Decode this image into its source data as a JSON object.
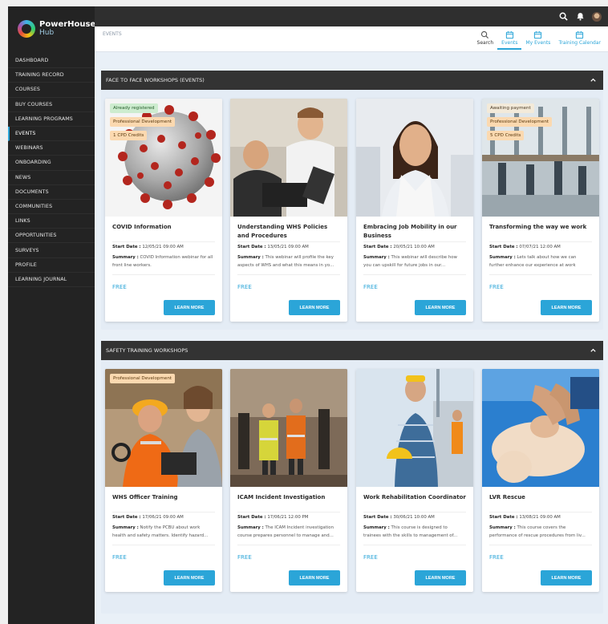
{
  "app": {
    "logo_line1": "PowerHouse",
    "logo_line2": "Hub"
  },
  "sidebar": {
    "items": [
      {
        "label": "DASHBOARD"
      },
      {
        "label": "TRAINING RECORD"
      },
      {
        "label": "COURSES"
      },
      {
        "label": "BUY COURSES"
      },
      {
        "label": "LEARNING PROGRAMS"
      },
      {
        "label": "EVENTS",
        "active": true
      },
      {
        "label": "WEBINARS"
      },
      {
        "label": "ONBOARDING"
      },
      {
        "label": "NEWS"
      },
      {
        "label": "DOCUMENTS"
      },
      {
        "label": "COMMUNITIES"
      },
      {
        "label": "LINKS"
      },
      {
        "label": "OPPORTUNITIES"
      },
      {
        "label": "SURVEYS"
      },
      {
        "label": "PROFILE"
      },
      {
        "label": "LEARNING JOURNAL"
      }
    ]
  },
  "breadcrumb": "EVENTS",
  "subnav": {
    "search": "Search",
    "events": "Events",
    "my_events": "My Events",
    "training_calendar": "Training Calendar"
  },
  "colors": {
    "accent": "#2ba5d8",
    "sidebar_bg": "#232323",
    "section_head": "#333333"
  },
  "sections": [
    {
      "title": "FACE TO FACE WORKSHOPS (EVENTS)",
      "cards": [
        {
          "title": "COVID Information",
          "badges": [
            "Already registered",
            "Professional Development",
            "1 CPD Credits"
          ],
          "start_label": "Start Date :",
          "start_date": "12/05/21 09:00 AM",
          "summary_label": "Summary :",
          "summary": "COVID Information webinar for all front line workers.",
          "price": "FREE",
          "button": "LEARN MORE"
        },
        {
          "title": "Understanding WHS Policies and Procedures",
          "badges": [],
          "start_label": "Start Date :",
          "start_date": "13/05/21 09:00 AM",
          "summary_label": "Summary :",
          "summary": "This webinar will profile the key aspects of WHS and what this means in yo...",
          "price": "FREE",
          "button": "LEARN MORE"
        },
        {
          "title": "Embracing Job Mobility in our Business",
          "badges": [],
          "start_label": "Start Date :",
          "start_date": "20/05/21 10:00 AM",
          "summary_label": "Summary :",
          "summary": "This webinar will describe how you can upskill for future jobs in our...",
          "price": "FREE",
          "button": "LEARN MORE"
        },
        {
          "title": "Transforming the way we work",
          "badges": [
            "Awaiting payment",
            "Professional Development",
            "5 CPD Credits"
          ],
          "start_label": "Start Date :",
          "start_date": "07/07/21 12:00 AM",
          "summary_label": "Summary :",
          "summary": "Lets talk about how we can further enhance our experience at work",
          "price": "FREE",
          "button": "LEARN MORE"
        }
      ]
    },
    {
      "title": "SAFETY TRAINING WORKSHOPS",
      "cards": [
        {
          "title": "WHS Officer Training",
          "badges": [
            "Professional Development"
          ],
          "start_label": "Start Date :",
          "start_date": "17/06/21 09:00 AM",
          "summary_label": "Summary :",
          "summary": "Notify the PCBU about work health and safety matters. Identify hazard...",
          "price": "FREE",
          "button": "LEARN MORE"
        },
        {
          "title": "ICAM Incident Investigation",
          "badges": [],
          "start_label": "Start Date :",
          "start_date": "17/06/21 12:00 PM",
          "summary_label": "Summary :",
          "summary": "The ICAM Incident investigation course prepares personnel to manage and...",
          "price": "FREE",
          "button": "LEARN MORE"
        },
        {
          "title": "Work Rehabilitation Coordinator",
          "badges": [],
          "start_label": "Start Date :",
          "start_date": "30/06/21 10:00 AM",
          "summary_label": "Summary :",
          "summary": "This course is designed to trainees with the skills to management of...",
          "price": "FREE",
          "button": "LEARN MORE"
        },
        {
          "title": "LVR Rescue",
          "badges": [],
          "start_label": "Start Date :",
          "start_date": "13/08/21 09:00 AM",
          "summary_label": "Summary :",
          "summary": "This course covers the performance of rescue procedures from liv...",
          "price": "FREE",
          "button": "LEARN MORE"
        }
      ]
    }
  ]
}
